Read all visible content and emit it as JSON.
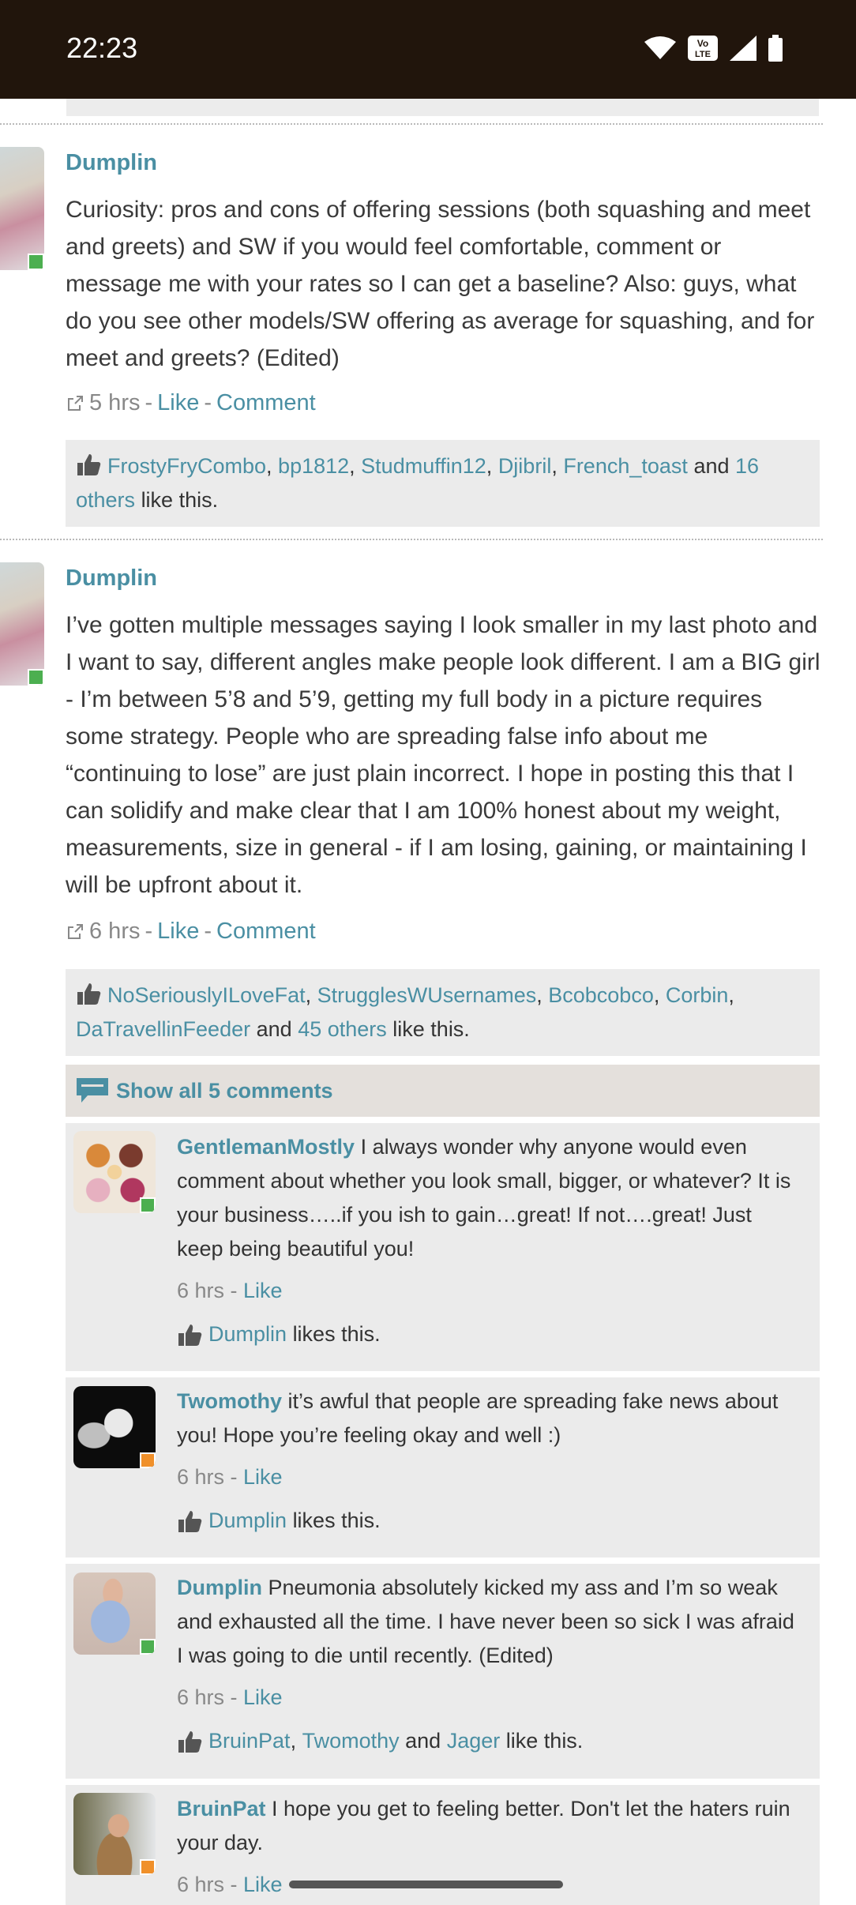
{
  "status_bar": {
    "time": "22:23",
    "volte": "Vo LTE"
  },
  "posts": [
    {
      "author": "Dumplin",
      "text": "Curiosity: pros and cons of offering sessions (both squashing and meet and greets) and SW if you would feel comfortable, comment or message me with your rates so I can get a baseline? Also: guys, what do you see other models/SW offering as average for squashing, and for meet and greets? (Edited)",
      "time": "5 hrs",
      "like_label": "Like",
      "comment_label": "Comment",
      "likes": {
        "names": [
          "FrostyFryCombo",
          "bp1812",
          "Studmuffin12",
          "Djibril",
          "French_toast"
        ],
        "and": "and",
        "others": "16 others",
        "suffix": "like this."
      }
    },
    {
      "author": "Dumplin",
      "text": "I’ve gotten multiple messages saying I look smaller in my last photo and I want to say, different angles make people look different. I am a BIG girl - I’m between 5’8 and 5’9, getting my full body in a picture requires some strategy. People who are spreading false info about me “continuing to lose” are just plain incorrect. I hope in posting this that I can solidify and make clear that I am 100% honest about my weight, measurements, size in general - if I am losing, gaining, or maintaining I will be upfront about it.",
      "time": "6 hrs",
      "like_label": "Like",
      "comment_label": "Comment",
      "likes": {
        "names": [
          "NoSeriouslyILoveFat",
          "StrugglesWUsernames",
          "Bcobcobco",
          "Corbin",
          "DaTravellinFeeder"
        ],
        "and": "and",
        "others": "45 others",
        "suffix": "like this."
      },
      "show_all_label": "Show all 5 comments",
      "comments": [
        {
          "author": "GentlemanMostly",
          "text": "I always wonder why anyone would even comment about whether you look small, bigger, or whatever? It is your business…..if you ish to gain…great! If not….great! Just keep being beautiful you!",
          "time": "6 hrs",
          "like_label": "Like",
          "likes_text": "Dumplin",
          "likes_suffix": "likes this."
        },
        {
          "author": "Twomothy",
          "text": "it’s awful that people are spreading fake news about you! Hope you’re feeling okay and well :)",
          "time": "6 hrs",
          "like_label": "Like",
          "likes_text": "Dumplin",
          "likes_suffix": "likes this."
        },
        {
          "author": "Dumplin",
          "text": "Pneumonia absolutely kicked my ass and I’m so weak and exhausted all the time. I have never been so sick I was afraid I was going to die until recently. (Edited)",
          "time": "6 hrs",
          "like_label": "Like",
          "likes_names": [
            "BruinPat",
            "Twomothy",
            "Jager"
          ],
          "likes_and": "and",
          "likes_suffix": "like this."
        },
        {
          "author": "BruinPat",
          "text": "I hope you get to feeling better. Don't let the haters ruin your day.",
          "time": "6 hrs",
          "like_label": "Like"
        }
      ]
    }
  ],
  "colors": {
    "link": "#4a8fa3",
    "status_bar": "#21150c",
    "online": "#4caf50",
    "away": "#f0902a"
  }
}
